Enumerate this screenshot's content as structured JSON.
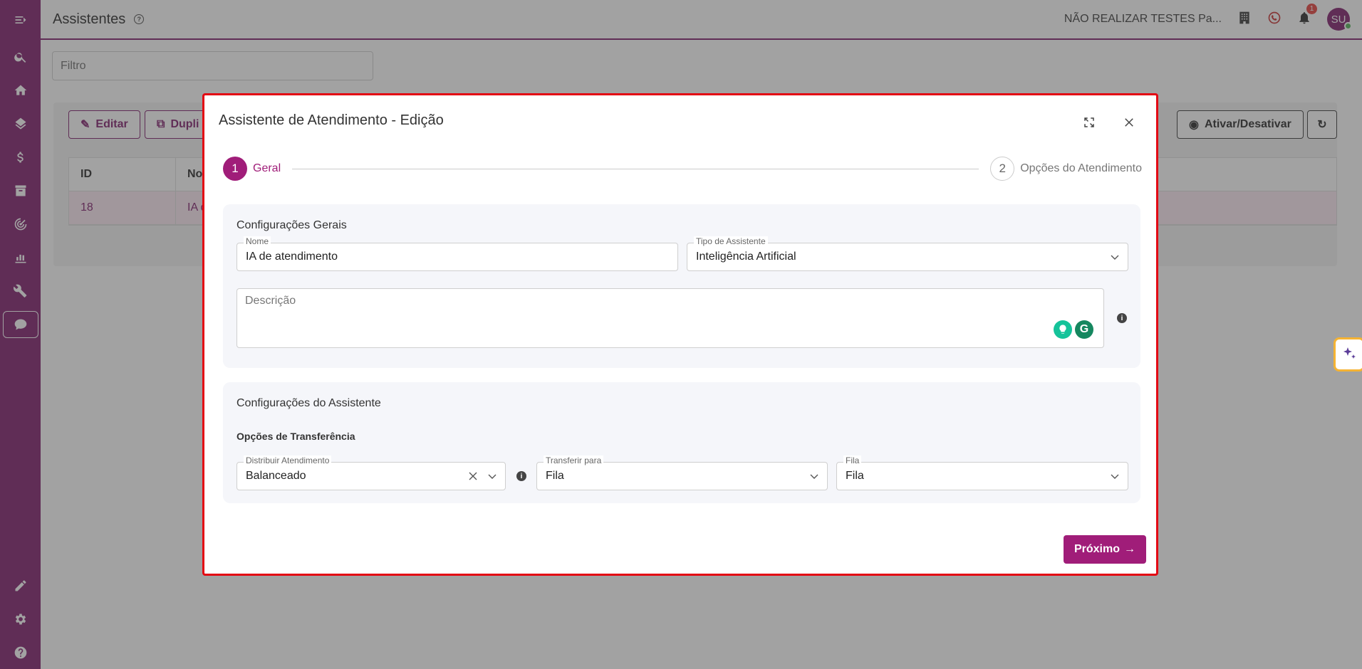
{
  "header": {
    "title": "Assistentes",
    "tenant": "NÃO REALIZAR TESTES Pa...",
    "notification_count": "1",
    "avatar_initials": "SU"
  },
  "filter": {
    "placeholder": "Filtro"
  },
  "toolbar": {
    "edit_label": "Editar",
    "duplicate_label": "Dupli",
    "toggle_label": "Ativar/Desativar"
  },
  "table": {
    "columns": [
      "ID",
      "No"
    ],
    "rows": [
      {
        "id": "18",
        "name": "IA d"
      }
    ]
  },
  "modal": {
    "title": "Assistente de Atendimento - Edição",
    "steps": [
      {
        "number": "1",
        "label": "Geral"
      },
      {
        "number": "2",
        "label": "Opções do Atendimento"
      }
    ],
    "general": {
      "title": "Configurações Gerais",
      "name_label": "Nome",
      "name_value": "IA de atendimento",
      "type_label": "Tipo de Assistente",
      "type_value": "Inteligência Artificial",
      "description_placeholder": "Descrição"
    },
    "assistant": {
      "title": "Configurações do Assistente",
      "transfer_title": "Opções de Transferência",
      "distribute_label": "Distribuir Atendimento",
      "distribute_value": "Balanceado",
      "transfer_label": "Transferir para",
      "transfer_value": "Fila",
      "queue_label": "Fila",
      "queue_value": "Fila"
    },
    "next_label": "Próximo"
  },
  "colors": {
    "brand": "#7a1466",
    "accent": "#a01d79",
    "highlight_border": "#e30613"
  }
}
